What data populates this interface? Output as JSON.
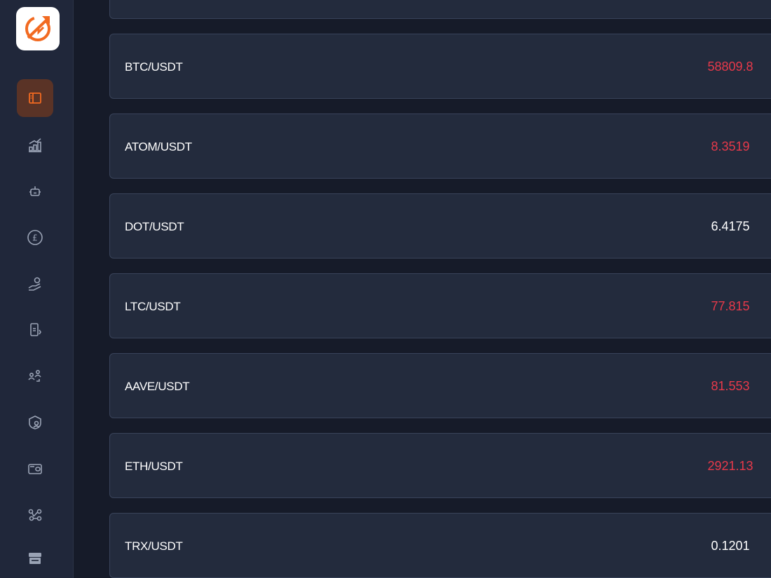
{
  "brand": {
    "logo_icon": "trade-logo-icon",
    "accent": "#f26a21"
  },
  "sidebar": {
    "items": [
      {
        "icon": "sidebar-panel-icon",
        "active": true
      },
      {
        "icon": "chart-bars-icon",
        "active": false
      },
      {
        "icon": "robot-icon",
        "active": false
      },
      {
        "icon": "pound-coin-icon",
        "active": false
      },
      {
        "icon": "hand-coin-icon",
        "active": false
      },
      {
        "icon": "phone-transfer-icon",
        "active": false
      },
      {
        "icon": "users-exchange-icon",
        "active": false
      },
      {
        "icon": "shield-user-icon",
        "active": false
      },
      {
        "icon": "wallet-icon",
        "active": false
      },
      {
        "icon": "network-nodes-icon",
        "active": false
      },
      {
        "icon": "store-icon",
        "active": false
      }
    ]
  },
  "colors": {
    "down": "#e8394a",
    "neutral": "#ffffff",
    "background": "#161b29",
    "card": "#232b3d"
  },
  "pairs": [
    {
      "symbol": "BTC/USDT",
      "price": "58809.8",
      "trend": "down"
    },
    {
      "symbol": "ATOM/USDT",
      "price": "8.3519",
      "trend": "down"
    },
    {
      "symbol": "DOT/USDT",
      "price": "6.4175",
      "trend": "flat"
    },
    {
      "symbol": "LTC/USDT",
      "price": "77.815",
      "trend": "down"
    },
    {
      "symbol": "AAVE/USDT",
      "price": "81.553",
      "trend": "down"
    },
    {
      "symbol": "ETH/USDT",
      "price": "2921.13",
      "trend": "down"
    },
    {
      "symbol": "TRX/USDT",
      "price": "0.1201",
      "trend": "flat"
    }
  ]
}
